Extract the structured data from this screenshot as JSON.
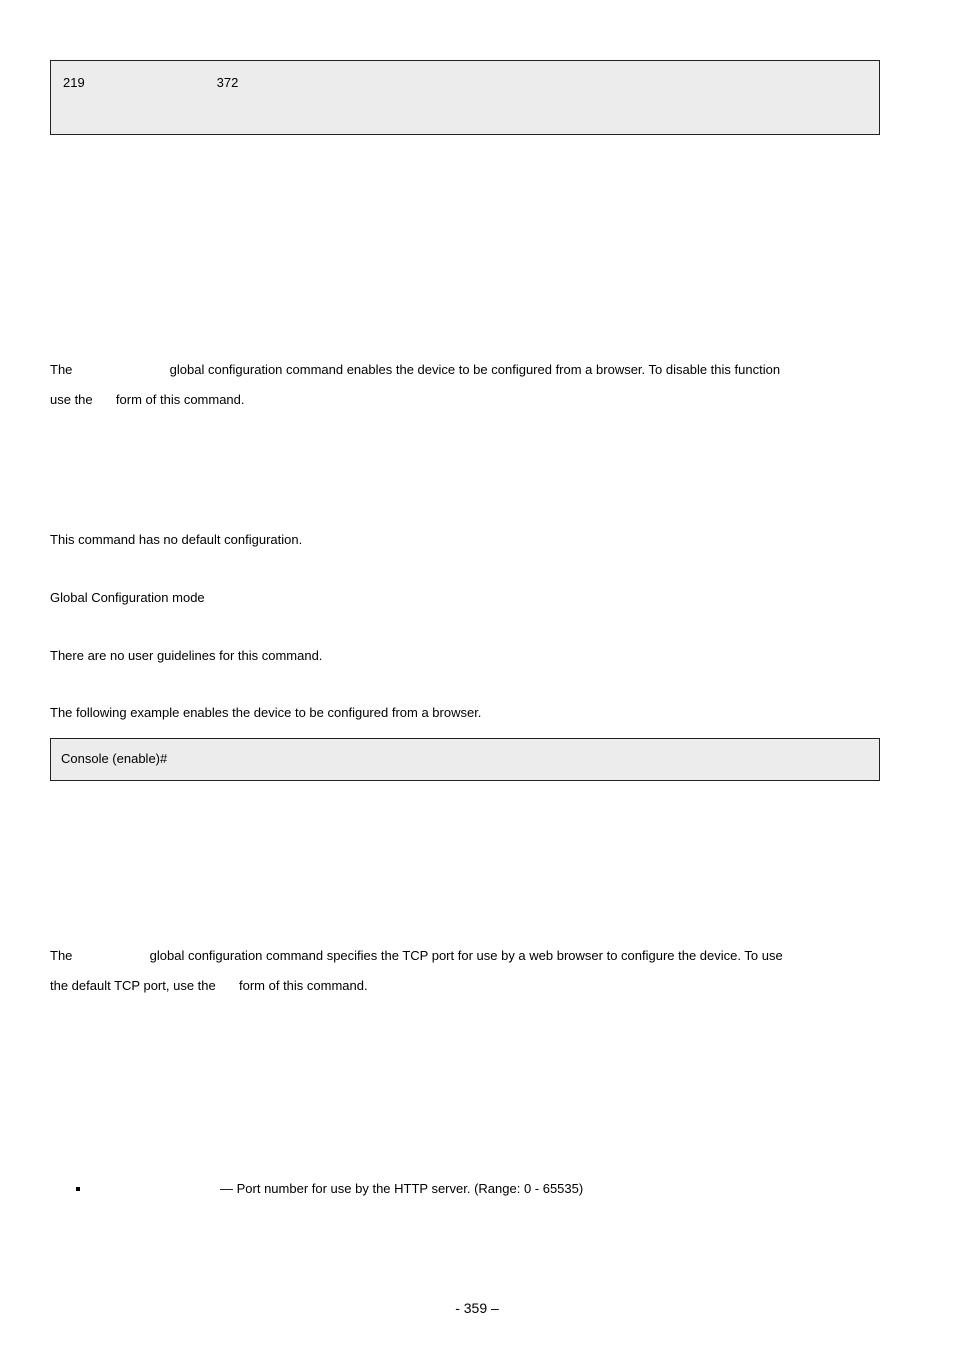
{
  "box_top": {
    "n1": "219",
    "n2": "372"
  },
  "section1": {
    "p1a": "The",
    "p1b": "global configuration command enables the device to be configured from a browser. To disable this function",
    "p2a": "use the",
    "p2b": "form of this command.",
    "default_cfg": "This command has no default configuration.",
    "mode": "Global Configuration mode",
    "guidelines": "There are no user guidelines for this command.",
    "example_intro": "The following example enables the device to be configured from a browser.",
    "code": "Console (enable)#"
  },
  "section2": {
    "p1a": "The",
    "p1b": "global configuration command specifies the TCP port for use by a web browser to configure the device. To use",
    "p2a": "the default TCP port, use the",
    "p2b": "form of this command.",
    "bullet": "— Port number for use by the HTTP server. (Range: 0 - 65535)"
  },
  "footer": "- 359 –"
}
